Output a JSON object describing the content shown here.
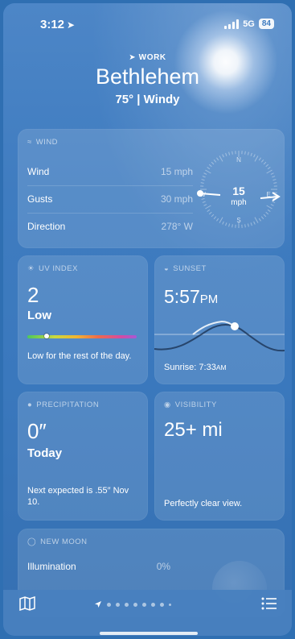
{
  "status_bar": {
    "time": "3:12",
    "network": "5G",
    "battery": "84"
  },
  "header": {
    "label": "WORK",
    "city": "Bethlehem",
    "conditions": "75° | Windy"
  },
  "wind": {
    "title": "WIND",
    "rows": [
      {
        "label": "Wind",
        "value": "15 mph"
      },
      {
        "label": "Gusts",
        "value": "30 mph"
      },
      {
        "label": "Direction",
        "value": "278° W"
      }
    ],
    "compass": {
      "speed": "15",
      "unit": "mph",
      "n": "N",
      "e": "E",
      "s": "S",
      "w": "W"
    }
  },
  "uv": {
    "title": "UV INDEX",
    "value": "2",
    "level": "Low",
    "note": "Low for the rest of the day.",
    "level_fraction": 0.18
  },
  "sunset": {
    "title": "SUNSET",
    "time": "5:57",
    "ampm": "PM",
    "sunrise_label": "Sunrise: 7:33",
    "sunrise_ampm": "AM"
  },
  "precipitation": {
    "title": "PRECIPITATION",
    "value": "0″",
    "period": "Today",
    "note": "Next expected is .55″ Nov 10."
  },
  "visibility": {
    "title": "VISIBILITY",
    "value": "25+ mi",
    "note": "Perfectly clear view."
  },
  "moon": {
    "title": "NEW MOON",
    "illumination_label": "Illumination",
    "illumination_value": "0%"
  },
  "icons": {
    "location": "location-arrow-icon",
    "wind": "wind-icon",
    "uv": "sun-icon",
    "sunset": "sunset-icon",
    "precip": "raindrop-icon",
    "visibility": "eye-icon",
    "moon": "moon-icon",
    "map": "map-icon",
    "list": "list-icon"
  },
  "pager": {
    "pages": 9,
    "current": 0
  }
}
